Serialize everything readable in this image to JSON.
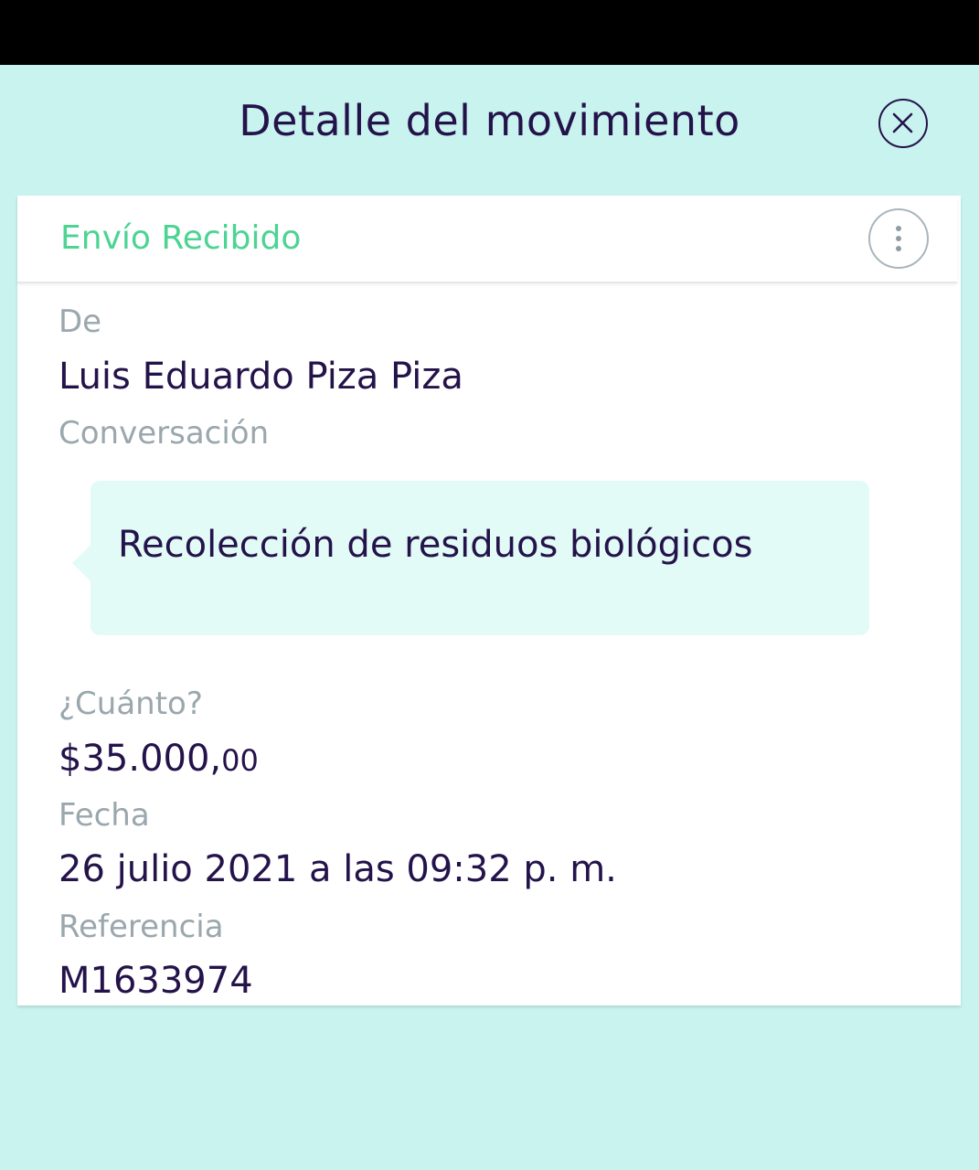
{
  "header": {
    "title": "Detalle del movimiento"
  },
  "card": {
    "status": "Envío Recibido",
    "from_label": "De",
    "from_value": "Luis Eduardo Piza Piza",
    "conversation_label": "Conversación",
    "conversation_message": "Recolección de residuos biológicos",
    "amount_label": "¿Cuánto?",
    "amount_main": "$35.000,",
    "amount_cents": "00",
    "date_label": "Fecha",
    "date_value": "26 julio 2021 a las 09:32 p. m.",
    "reference_label": "Referencia",
    "reference_value": "M1633974"
  },
  "colors": {
    "background": "#c8f3ef",
    "primary_text": "#24134a",
    "status_green": "#4cd493",
    "label_gray": "#9aa7ad",
    "bubble": "#e2fbf7"
  },
  "icons": {
    "close": "close-circle-icon",
    "more": "more-vertical-icon"
  }
}
